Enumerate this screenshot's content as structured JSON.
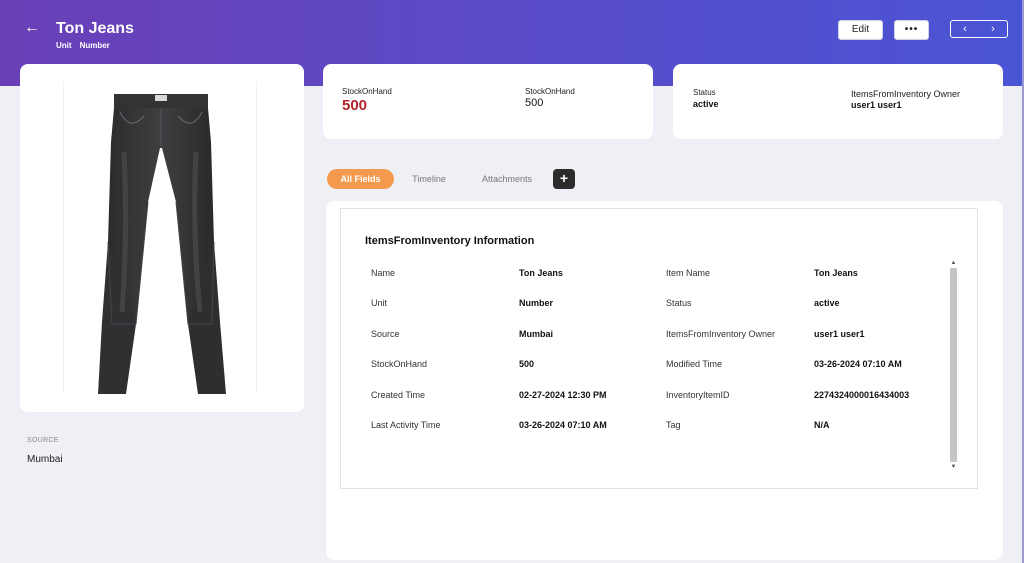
{
  "header": {
    "title": "Ton Jeans",
    "subtitle": [
      "Unit",
      "Number"
    ],
    "back_icon": "arrow-left-icon",
    "edit_label": "Edit",
    "more_label": "•••",
    "prev_icon": "‹",
    "next_icon": "›"
  },
  "stock": {
    "label1": "StockOnHand",
    "value1": "500",
    "label2": "StockOnHand",
    "value2": "500"
  },
  "status_card": {
    "status_label": "Status",
    "status_value": "active",
    "owner_label": "ItemsFromInventory Owner",
    "owner_value": "user1 user1"
  },
  "sidebar": {
    "source_label": "SOURCE",
    "source_value": "Mumbai"
  },
  "tabs": {
    "all_fields": "All Fields",
    "timeline": "Timeline",
    "attachments": "Attachments",
    "add": "+"
  },
  "info": {
    "title": "ItemsFromInventory Information",
    "left": [
      {
        "label": "Name",
        "value": "Ton Jeans"
      },
      {
        "label": "Unit",
        "value": "Number"
      },
      {
        "label": "Source",
        "value": "Mumbai"
      },
      {
        "label": "StockOnHand",
        "value": "500"
      },
      {
        "label": "Created Time",
        "value": "02-27-2024 12:30 PM"
      },
      {
        "label": "Last Activity Time",
        "value": "03-26-2024 07:10 AM"
      }
    ],
    "right": [
      {
        "label": "Item Name",
        "value": "Ton Jeans"
      },
      {
        "label": "Status",
        "value": "active"
      },
      {
        "label": "ItemsFromInventory Owner",
        "value": "user1 user1"
      },
      {
        "label": "Modified Time",
        "value": "03-26-2024 07:10 AM"
      },
      {
        "label": "InventoryItemID",
        "value": "2274324000016434003"
      },
      {
        "label": "Tag",
        "value": "N/A"
      }
    ]
  },
  "colors": {
    "accent_orange": "#f39a4f",
    "stock_red": "#b3262b",
    "header_start": "#6a3fb6",
    "header_end": "#4a55d6"
  }
}
